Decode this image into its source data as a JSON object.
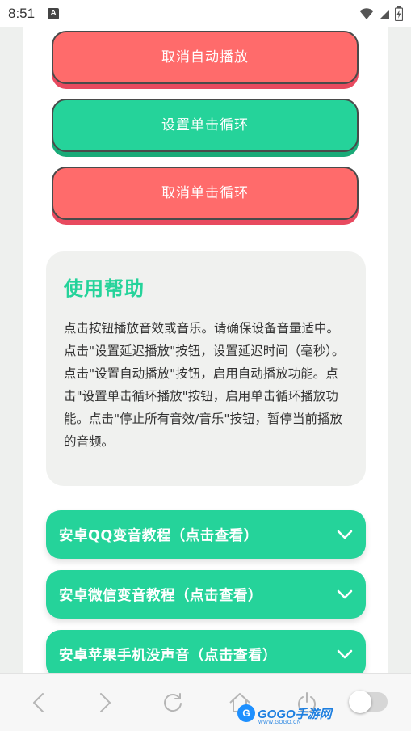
{
  "status_bar": {
    "time": "8:51",
    "notification_icon": "a-notification-icon",
    "right_icons": [
      "wifi-icon",
      "signal-icon",
      "battery-charging-icon"
    ]
  },
  "buttons": [
    {
      "label": "取消自动播放",
      "color": "#ff6b6b"
    },
    {
      "label": "设置单击循环",
      "color": "#25d39a"
    },
    {
      "label": "取消单击循环",
      "color": "#ff6b6b"
    }
  ],
  "help": {
    "title": "使用帮助",
    "text": "点击按钮播放音效或音乐。请确保设备音量适中。点击\"设置延迟播放\"按钮，设置延迟时间（毫秒）。点击\"设置自动播放\"按钮，启用自动播放功能。点击\"设置单击循环播放\"按钮，启用单击循环播放功能。点击\"停止所有音效/音乐\"按钮，暂停当前播放的音频。"
  },
  "accordions": [
    {
      "label": "安卓QQ变音教程（点击查看）"
    },
    {
      "label": "安卓微信变音教程（点击查看）"
    },
    {
      "label": "安卓苹果手机没声音（点击查看）"
    }
  ],
  "bottom_nav": {
    "icons": [
      "back-icon",
      "forward-icon",
      "refresh-icon",
      "home-icon",
      "power-icon",
      "toggle-switch"
    ],
    "watermark_text": "GOGO手游网",
    "watermark_sub": "WWW.GOGO.CN",
    "watermark_badge": "G"
  },
  "colors": {
    "accent_green": "#25d39a",
    "accent_red": "#ff6b6b",
    "help_bg": "#f0f1ef"
  }
}
